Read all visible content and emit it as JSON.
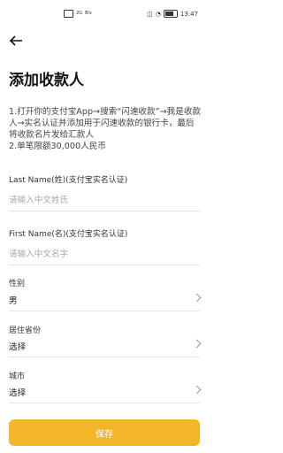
{
  "status_bar": {
    "network": "2G",
    "speed": "B/s",
    "time": "13:47"
  },
  "page": {
    "title": "添加收款人",
    "description": "1.打开你的支付宝App→搜索“闪速收款”→我是收款人→实名认证并添加用于闪速收款的银行卡，最后将收款名片发给汇款人\n2.单笔限额30,000人民币"
  },
  "form": {
    "last_name": {
      "label": "Last Name(姓)(支付宝实名认证)",
      "placeholder": "请输入中文姓氏",
      "value": ""
    },
    "first_name": {
      "label": "First Name(名)(支付宝实名认证)",
      "placeholder": "请输入中文名字",
      "value": ""
    },
    "gender": {
      "label": "性别",
      "value": "男"
    },
    "province": {
      "label": "居住省份",
      "value": "选择"
    },
    "city": {
      "label": "城市",
      "value": "选择"
    },
    "save_label": "保存"
  },
  "colors": {
    "accent": "#f3b629"
  }
}
